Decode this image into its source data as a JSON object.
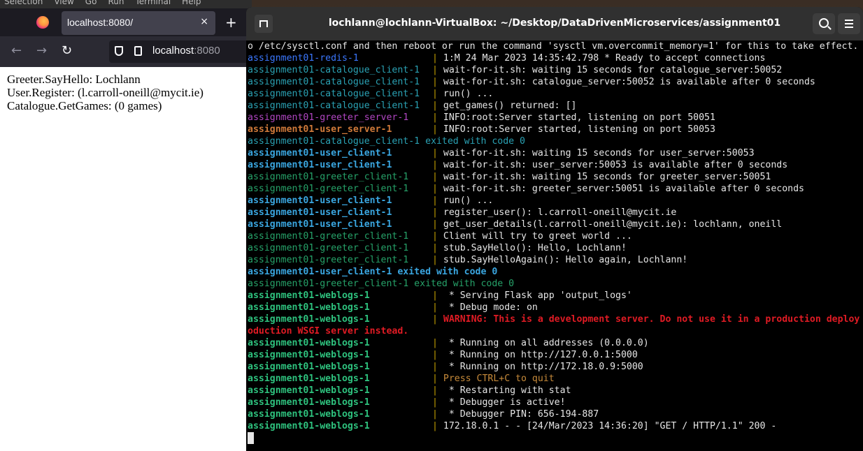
{
  "background_menubar": {
    "items": [
      "Selection",
      "View",
      "Go",
      "Run",
      "Terminal",
      "Help"
    ]
  },
  "browser": {
    "tab_title": "localhost:8080/",
    "tab_close": "×",
    "new_tab": "+",
    "url_host": "localhost",
    "url_port": ":8080",
    "nav": {
      "back": "←",
      "forward": "→",
      "reload": "↻"
    },
    "content_lines": [
      "Greeter.SayHello: Lochlann",
      "User.Register: (l.carroll-oneill@mycit.ie)",
      "Catalogue.GetGames: (0 games)"
    ]
  },
  "terminal": {
    "title": "lochlann@lochlann-VirtualBox: ~/Desktop/DataDrivenMicroservices/assignment01",
    "lines": [
      {
        "prefix": "",
        "sep": "",
        "msg": "o /etc/sysctl.conf and then reboot or run the command 'sysctl vm.overcommit_memory=1' for this to take effect.",
        "pc": "c-plain",
        "mc": "c-plain"
      },
      {
        "prefix": "assignment01-redis-1",
        "sep": "|",
        "msg": " 1:M 24 Mar 2023 14:35:42.798 * Ready to accept connections",
        "pc": "c-redis",
        "mc": "c-plain"
      },
      {
        "prefix": "assignment01-catalogue_client-1",
        "sep": "|",
        "msg": " wait-for-it.sh: waiting 15 seconds for catalogue_server:50052",
        "pc": "c-catalogue",
        "mc": "c-plain"
      },
      {
        "prefix": "assignment01-catalogue_client-1",
        "sep": "|",
        "msg": " wait-for-it.sh: catalogue_server:50052 is available after 0 seconds",
        "pc": "c-catalogue",
        "mc": "c-plain"
      },
      {
        "prefix": "assignment01-catalogue_client-1",
        "sep": "|",
        "msg": " run() ...",
        "pc": "c-catalogue",
        "mc": "c-plain"
      },
      {
        "prefix": "assignment01-catalogue_client-1",
        "sep": "|",
        "msg": " get_games() returned: []",
        "pc": "c-catalogue",
        "mc": "c-plain"
      },
      {
        "prefix": "assignment01-greeter_server-1",
        "sep": "|",
        "msg": " INFO:root:Server started, listening on port 50051",
        "pc": "c-greeter-server",
        "mc": "c-plain"
      },
      {
        "prefix": "assignment01-user_server-1",
        "sep": "|",
        "msg": " INFO:root:Server started, listening on port 50053",
        "pc": "c-user-server",
        "mc": "c-plain"
      },
      {
        "prefix": "",
        "sep": "",
        "msg": "assignment01-catalogue_client-1 exited with code 0",
        "pc": "c-plain",
        "mc": "c-catalogue"
      },
      {
        "prefix": "assignment01-user_client-1",
        "sep": "|",
        "msg": " wait-for-it.sh: waiting 15 seconds for user_server:50053",
        "pc": "c-user-client",
        "mc": "c-plain"
      },
      {
        "prefix": "assignment01-user_client-1",
        "sep": "|",
        "msg": " wait-for-it.sh: user_server:50053 is available after 0 seconds",
        "pc": "c-user-client",
        "mc": "c-plain"
      },
      {
        "prefix": "assignment01-greeter_client-1",
        "sep": "|",
        "msg": " wait-for-it.sh: waiting 15 seconds for greeter_server:50051",
        "pc": "c-greeter-client",
        "mc": "c-plain"
      },
      {
        "prefix": "assignment01-greeter_client-1",
        "sep": "|",
        "msg": " wait-for-it.sh: greeter_server:50051 is available after 0 seconds",
        "pc": "c-greeter-client",
        "mc": "c-plain"
      },
      {
        "prefix": "assignment01-user_client-1",
        "sep": "|",
        "msg": " run() ...",
        "pc": "c-user-client",
        "mc": "c-plain"
      },
      {
        "prefix": "assignment01-user_client-1",
        "sep": "|",
        "msg": " register_user(): l.carroll-oneill@mycit.ie",
        "pc": "c-user-client",
        "mc": "c-plain"
      },
      {
        "prefix": "assignment01-user_client-1",
        "sep": "|",
        "msg": " get_user_details(l.carroll-oneill@mycit.ie): lochlann, oneill",
        "pc": "c-user-client",
        "mc": "c-plain"
      },
      {
        "prefix": "assignment01-greeter_client-1",
        "sep": "|",
        "msg": " Client will try to greet world ...",
        "pc": "c-greeter-client",
        "mc": "c-plain"
      },
      {
        "prefix": "assignment01-greeter_client-1",
        "sep": "|",
        "msg": " stub.SayHello(): Hello, Lochlann!",
        "pc": "c-greeter-client",
        "mc": "c-plain"
      },
      {
        "prefix": "assignment01-greeter_client-1",
        "sep": "|",
        "msg": " stub.SayHelloAgain(): Hello again, Lochlann!",
        "pc": "c-greeter-client",
        "mc": "c-plain"
      },
      {
        "prefix": "",
        "sep": "",
        "msg": "assignment01-user_client-1 exited with code 0",
        "pc": "c-plain",
        "mc": "c-user-client"
      },
      {
        "prefix": "",
        "sep": "",
        "msg": "assignment01-greeter_client-1 exited with code 0",
        "pc": "c-plain",
        "mc": "c-greeter-client"
      },
      {
        "prefix": "assignment01-weblogs-1",
        "sep": "|",
        "msg": "  * Serving Flask app 'output_logs'",
        "pc": "c-weblogs",
        "mc": "c-plain"
      },
      {
        "prefix": "assignment01-weblogs-1",
        "sep": "|",
        "msg": "  * Debug mode: on",
        "pc": "c-weblogs",
        "mc": "c-plain"
      },
      {
        "prefix": "assignment01-weblogs-1",
        "sep": "|",
        "msg": " WARNING: This is a development server. Do not use it in a production deploy",
        "pc": "c-weblogs",
        "mc": "c-warning"
      },
      {
        "prefix": "",
        "sep": "",
        "msg": "oduction WSGI server instead.",
        "pc": "c-plain",
        "mc": "c-warning"
      },
      {
        "prefix": "assignment01-weblogs-1",
        "sep": "|",
        "msg": "  * Running on all addresses (0.0.0.0)",
        "pc": "c-weblogs",
        "mc": "c-plain"
      },
      {
        "prefix": "assignment01-weblogs-1",
        "sep": "|",
        "msg": "  * Running on http://127.0.0.1:5000",
        "pc": "c-weblogs",
        "mc": "c-plain"
      },
      {
        "prefix": "assignment01-weblogs-1",
        "sep": "|",
        "msg": "  * Running on http://172.18.0.9:5000",
        "pc": "c-weblogs",
        "mc": "c-plain"
      },
      {
        "prefix": "assignment01-weblogs-1",
        "sep": "|",
        "msg": " Press CTRL+C to quit",
        "pc": "c-weblogs",
        "mc": "c-orange"
      },
      {
        "prefix": "assignment01-weblogs-1",
        "sep": "|",
        "msg": "  * Restarting with stat",
        "pc": "c-weblogs",
        "mc": "c-plain"
      },
      {
        "prefix": "assignment01-weblogs-1",
        "sep": "|",
        "msg": "  * Debugger is active!",
        "pc": "c-weblogs",
        "mc": "c-plain"
      },
      {
        "prefix": "assignment01-weblogs-1",
        "sep": "|",
        "msg": "  * Debugger PIN: 656-194-887",
        "pc": "c-weblogs",
        "mc": "c-plain"
      },
      {
        "prefix": "assignment01-weblogs-1",
        "sep": "|",
        "msg": " 172.18.0.1 - - [24/Mar/2023 14:36:20] \"GET / HTTP/1.1\" 200 -",
        "pc": "c-weblogs",
        "mc": "c-plain"
      }
    ]
  }
}
